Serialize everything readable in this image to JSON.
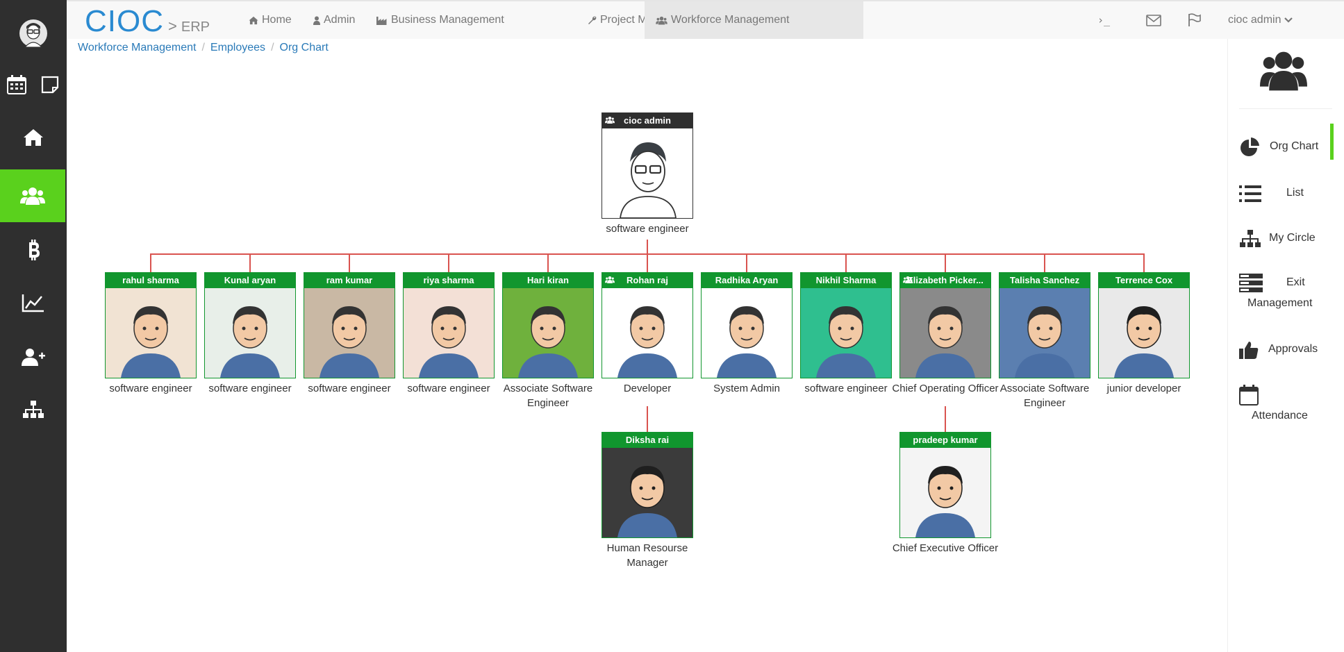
{
  "brand": {
    "name": "CIOC",
    "separator": ">",
    "sub": "ERP"
  },
  "nav": {
    "items": [
      {
        "label": "Home",
        "icon": "home-icon"
      },
      {
        "label": "Admin",
        "icon": "user-icon"
      },
      {
        "label": "Business Management",
        "icon": "factory-icon"
      },
      {
        "label": "Project Management",
        "icon": "wrench-icon"
      },
      {
        "label": "Workforce Management",
        "icon": "users-icon",
        "active": true
      }
    ],
    "terminal": "›_",
    "user": "cioc admin"
  },
  "breadcrumb": [
    "Workforce Management",
    "Employees",
    "Org Chart"
  ],
  "left_sidebar": {
    "items": [
      "avatar",
      "calendar-icon",
      "sticky-note-icon",
      "home-icon",
      "users-icon",
      "bitcoin-icon",
      "line-chart-icon",
      "add-user-icon",
      "sitemap-icon"
    ],
    "active": "users-icon"
  },
  "right_panel": {
    "items": [
      {
        "label": "Org Chart",
        "icon": "pie-chart-icon",
        "active": true
      },
      {
        "label": "List",
        "icon": "list-icon"
      },
      {
        "label": "My Circle",
        "icon": "sitemap-icon"
      },
      {
        "label": "Exit",
        "label2": "Management",
        "icon": "exit-icon"
      },
      {
        "label": "Approvals",
        "icon": "thumbs-up-icon"
      },
      {
        "label": "Attendance",
        "icon": "calendar-icon"
      }
    ]
  },
  "org_chart": {
    "root": {
      "name": "cioc admin",
      "title": "software engineer",
      "team": true
    },
    "reports": [
      {
        "name": "rahul sharma",
        "title": "software engineer"
      },
      {
        "name": "Kunal aryan",
        "title": "software engineer"
      },
      {
        "name": "ram kumar",
        "title": "software engineer"
      },
      {
        "name": "riya sharma",
        "title": "software engineer"
      },
      {
        "name": "Hari kiran",
        "title": "Associate Software Engineer"
      },
      {
        "name": "Rohan raj",
        "title": "Developer",
        "team": true
      },
      {
        "name": "Radhika Aryan",
        "title": "System Admin"
      },
      {
        "name": "Nikhil Sharma",
        "title": "software engineer"
      },
      {
        "name": "Elizabeth Picker...",
        "title": "Chief Operating Officer",
        "team": true
      },
      {
        "name": "Talisha Sanchez",
        "title": "Associate Software Engineer"
      },
      {
        "name": "Terrence Cox",
        "title": "junior developer"
      }
    ],
    "second_level": [
      {
        "name": "Diksha rai",
        "title": "Human Resourse Manager",
        "parent": "Rohan raj"
      },
      {
        "name": "pradeep kumar",
        "title": "Chief Executive Officer",
        "parent": "Elizabeth Picker..."
      }
    ]
  },
  "colors": {
    "sidebar": "#2f2f2f",
    "active_green": "#5ad11d",
    "card_green": "#11962e",
    "brand_blue": "#2a8ad1",
    "connector": "#d9534f"
  }
}
